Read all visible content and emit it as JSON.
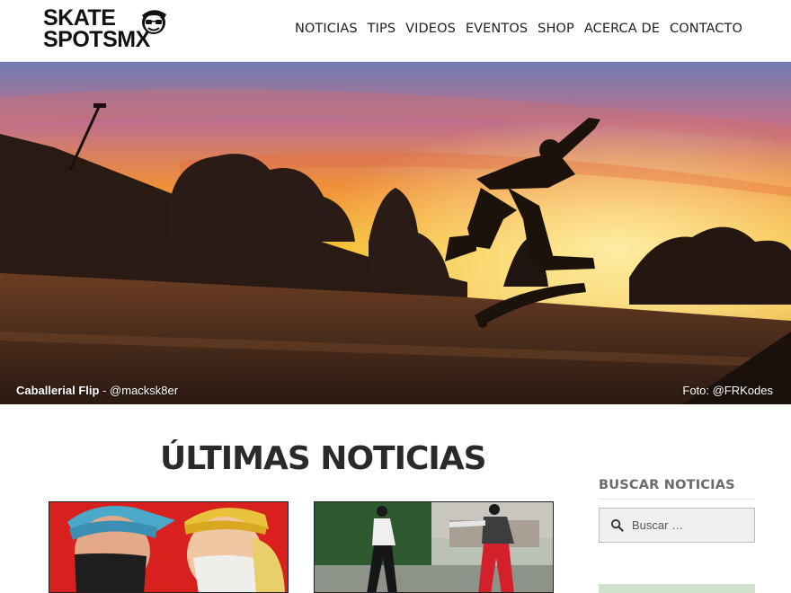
{
  "header": {
    "logo": {
      "line1": "SKATE",
      "line2": "SPOTSMX"
    },
    "nav": [
      "NOTICIAS",
      "TIPS",
      "VIDEOS",
      "EVENTOS",
      "SHOP",
      "ACERCA DE",
      "CONTACTO"
    ]
  },
  "hero": {
    "caption_trick": "Caballerial Flip",
    "caption_separator": " - ",
    "caption_author": "@macksk8er",
    "photo_credit": "Foto: @FRKodes"
  },
  "main": {
    "title": "ÚLTIMAS NOTICIAS"
  },
  "sidebar": {
    "search_title": "BUSCAR NOTICIAS",
    "search_placeholder": "Buscar …"
  },
  "colors": {
    "sky_top": "#6a7fb8",
    "sky_sunset": "#f2b227",
    "ground": "#3a2418",
    "sidebar_title": "#6b6b6b",
    "sidebar_widget": "#cfe3cc"
  }
}
